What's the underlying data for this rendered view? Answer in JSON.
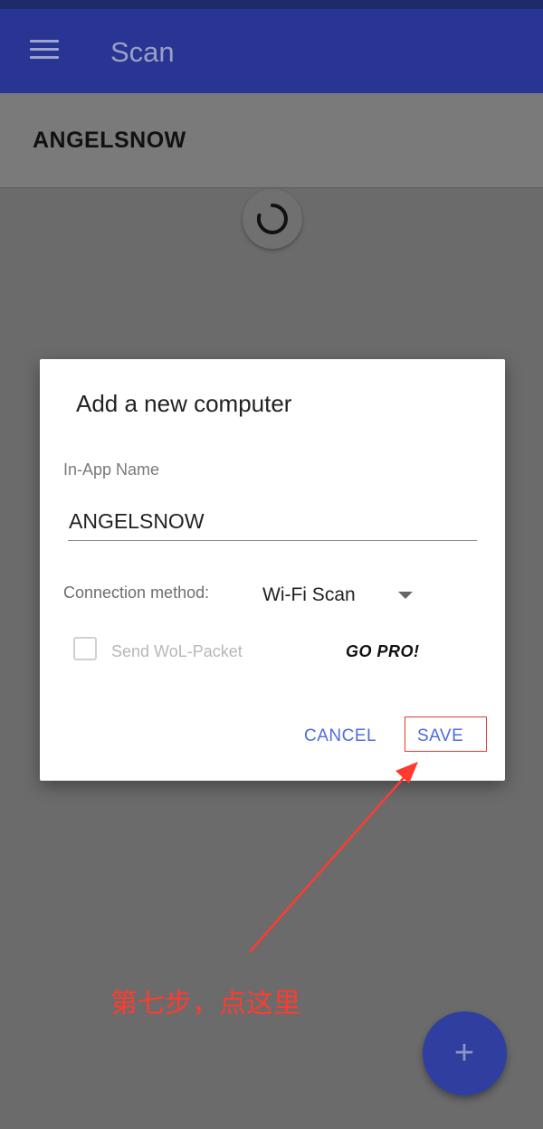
{
  "appbar": {
    "title": "Scan",
    "menu_icon": "menu-icon"
  },
  "device": {
    "name": "ANGELSNOW"
  },
  "dialog": {
    "title": "Add a new computer",
    "name_label": "In-App Name",
    "name_value": "ANGELSNOW",
    "connection_label": "Connection method:",
    "connection_value": "Wi-Fi Scan",
    "wol_label": "Send WoL-Packet",
    "wol_checked": false,
    "gopro_label": "GO PRO!",
    "cancel_label": "CANCEL",
    "save_label": "SAVE"
  },
  "fab": {
    "icon": "plus-icon",
    "label": "+"
  },
  "annotation": {
    "text": "第七步，点这里",
    "color": "#ff3b30"
  },
  "colors": {
    "appbar": "#283593",
    "accent": "#4f6cdf",
    "fab": "#303f9f",
    "annotation": "#ff3b30"
  }
}
